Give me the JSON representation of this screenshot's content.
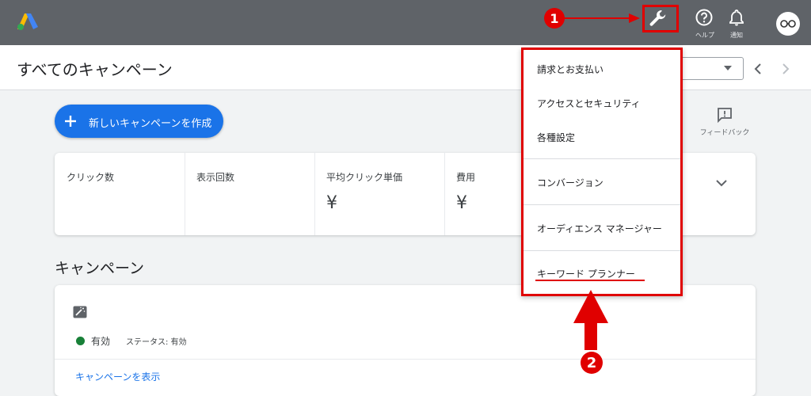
{
  "topbar": {
    "help_label": "ヘルプ",
    "notifications_label": "通知"
  },
  "header": {
    "page_title": "すべてのキャンペーン"
  },
  "toolbar": {
    "new_campaign_label": "新しいキャンペーンを作成",
    "feedback_label": "フィードバック"
  },
  "metrics": [
    {
      "label": "クリック数",
      "value": ""
    },
    {
      "label": "表示回数",
      "value": ""
    },
    {
      "label": "平均クリック単価",
      "value": "¥"
    },
    {
      "label": "費用",
      "value": "¥"
    }
  ],
  "campaigns": {
    "section_title": "キャンペーン",
    "status_text": "有効",
    "status_detail": "ステータス: 有効",
    "view_link": "キャンペーンを表示"
  },
  "tools_menu": {
    "items": [
      "請求とお支払い",
      "アクセスとセキュリティ",
      "各種設定",
      "コンバージョン",
      "オーディエンス マネージャー",
      "キーワード プランナー"
    ]
  },
  "annotations": {
    "step1": "1",
    "step2": "2",
    "highlight_color": "#e00000"
  },
  "colors": {
    "topbar": "#5f6368",
    "primary": "#1a73e8",
    "status_active": "#188038"
  }
}
